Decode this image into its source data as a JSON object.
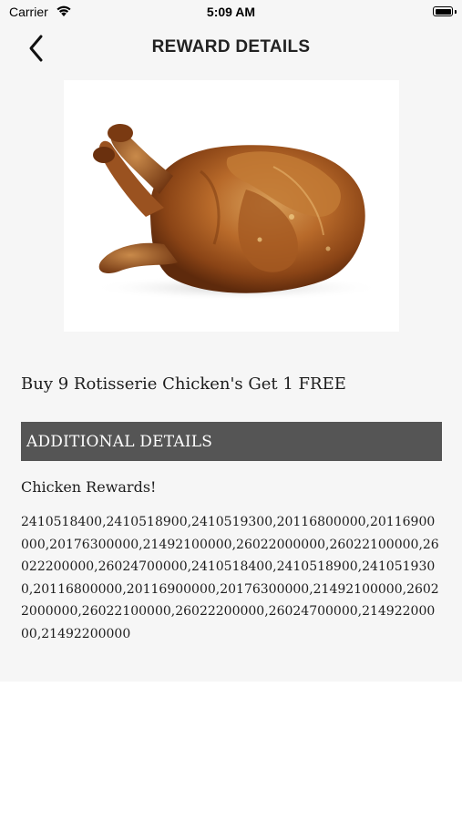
{
  "status_bar": {
    "carrier": "Carrier",
    "time": "5:09 AM"
  },
  "nav": {
    "title": "REWARD DETAILS",
    "back_icon": "chevron-left-icon"
  },
  "reward": {
    "image": "rotisserie-chicken-photo",
    "title": "Buy 9 Rotisserie Chicken's Get 1 FREE",
    "section_header": "ADDITIONAL DETAILS",
    "subtitle": "Chicken Rewards!",
    "codes": "2410518400,2410518900,2410519300,20116800000,20116900000,20176300000,21492100000,26022000000,26022100000,26022200000,26024700000,2410518400,2410518900,2410519300,20116800000,20116900000,20176300000,21492100000,26022000000,26022100000,26022200000,26024700000,21492200000,21492200000"
  },
  "colors": {
    "bar_background": "#f6f6f6",
    "section_header_background": "#555555",
    "section_header_text": "#ffffff",
    "body_text": "#1d1d1d"
  }
}
